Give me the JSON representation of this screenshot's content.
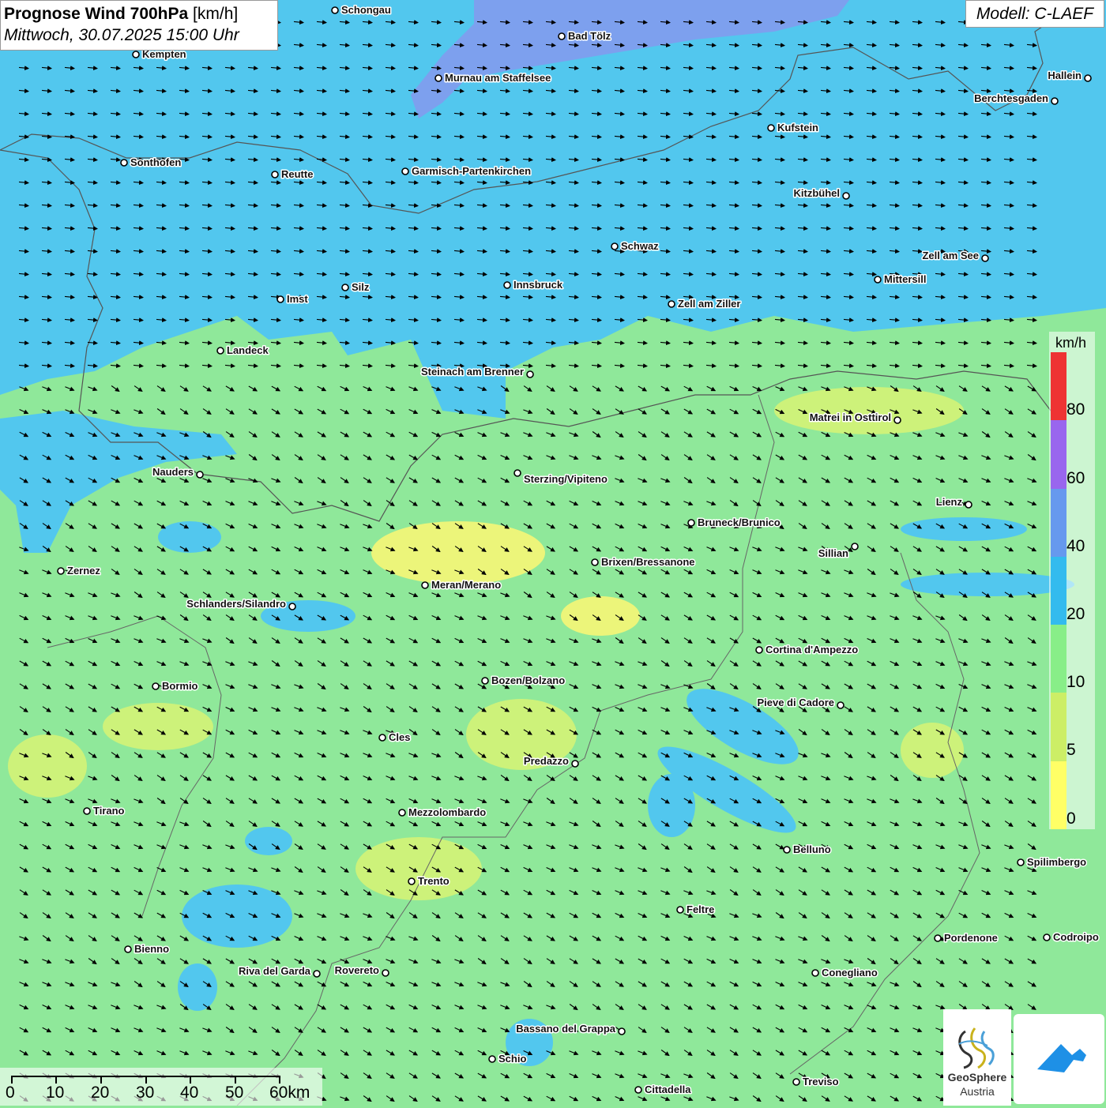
{
  "header": {
    "title": "Prognose Wind 700hPa",
    "unit": "[km/h]",
    "datetime": "Mittwoch, 30.07.2025 15:00 Uhr"
  },
  "model": {
    "label": "Modell: C-LAEF"
  },
  "legend": {
    "unit": "km/h",
    "ticks": [
      "80",
      "60",
      "40",
      "20",
      "10",
      "5",
      "0"
    ],
    "colors": {
      "above_80": "#ee3333",
      "60_80": "#9966ee",
      "40_60": "#6699ee",
      "20_40": "#33bbee",
      "10_20": "#88ee88",
      "5_10": "#ccee66",
      "0_5": "#ffff66"
    }
  },
  "scale": {
    "labels": [
      "0",
      "10",
      "20",
      "30",
      "40",
      "50",
      "60km"
    ]
  },
  "logos": {
    "geosphere_name": "GeoSphere",
    "geosphere_sub": "Austria",
    "geosphere_icon": "geosphere-logo-icon",
    "app_icon": "mountain-app-icon"
  },
  "wind": {
    "direction": "west-northwest",
    "arrow_icon": "wind-arrow-icon"
  },
  "cities": [
    {
      "name": "Schongau"
    },
    {
      "name": "Bad Tölz"
    },
    {
      "name": "Kempten"
    },
    {
      "name": "Murnau am Staffelsee"
    },
    {
      "name": "Hallein"
    },
    {
      "name": "Berchtesgaden"
    },
    {
      "name": "Kufstein"
    },
    {
      "name": "Sonthofen"
    },
    {
      "name": "Reutte"
    },
    {
      "name": "Garmisch-Partenkirchen"
    },
    {
      "name": "Kitzbühel"
    },
    {
      "name": "Schwaz"
    },
    {
      "name": "Zell am See"
    },
    {
      "name": "Mittersill"
    },
    {
      "name": "Innsbruck"
    },
    {
      "name": "Silz"
    },
    {
      "name": "Imst"
    },
    {
      "name": "Zell am Ziller"
    },
    {
      "name": "Landeck"
    },
    {
      "name": "Steinach am Brenner"
    },
    {
      "name": "Matrei in Osttirol"
    },
    {
      "name": "Nauders"
    },
    {
      "name": "Sterzing/Vipiteno"
    },
    {
      "name": "Lienz"
    },
    {
      "name": "Bruneck/Brunico"
    },
    {
      "name": "Sillian"
    },
    {
      "name": "Brixen/Bressanone"
    },
    {
      "name": "Zernez"
    },
    {
      "name": "Meran/Merano"
    },
    {
      "name": "Schlanders/Silandro"
    },
    {
      "name": "Cortina d'Ampezzo"
    },
    {
      "name": "Bozen/Bolzano"
    },
    {
      "name": "Bormio"
    },
    {
      "name": "Pieve di Cadore"
    },
    {
      "name": "Cles"
    },
    {
      "name": "Predazzo"
    },
    {
      "name": "Tirano"
    },
    {
      "name": "Mezzolombardo"
    },
    {
      "name": "Belluno"
    },
    {
      "name": "Spilimbergo"
    },
    {
      "name": "Trento"
    },
    {
      "name": "Feltre"
    },
    {
      "name": "Pordenone"
    },
    {
      "name": "Codroipo"
    },
    {
      "name": "Bienno"
    },
    {
      "name": "Riva del Garda"
    },
    {
      "name": "Rovereto"
    },
    {
      "name": "Conegliano"
    },
    {
      "name": "Bassano del Grappa"
    },
    {
      "name": "Schio"
    },
    {
      "name": "Treviso"
    },
    {
      "name": "Cittadella"
    }
  ]
}
